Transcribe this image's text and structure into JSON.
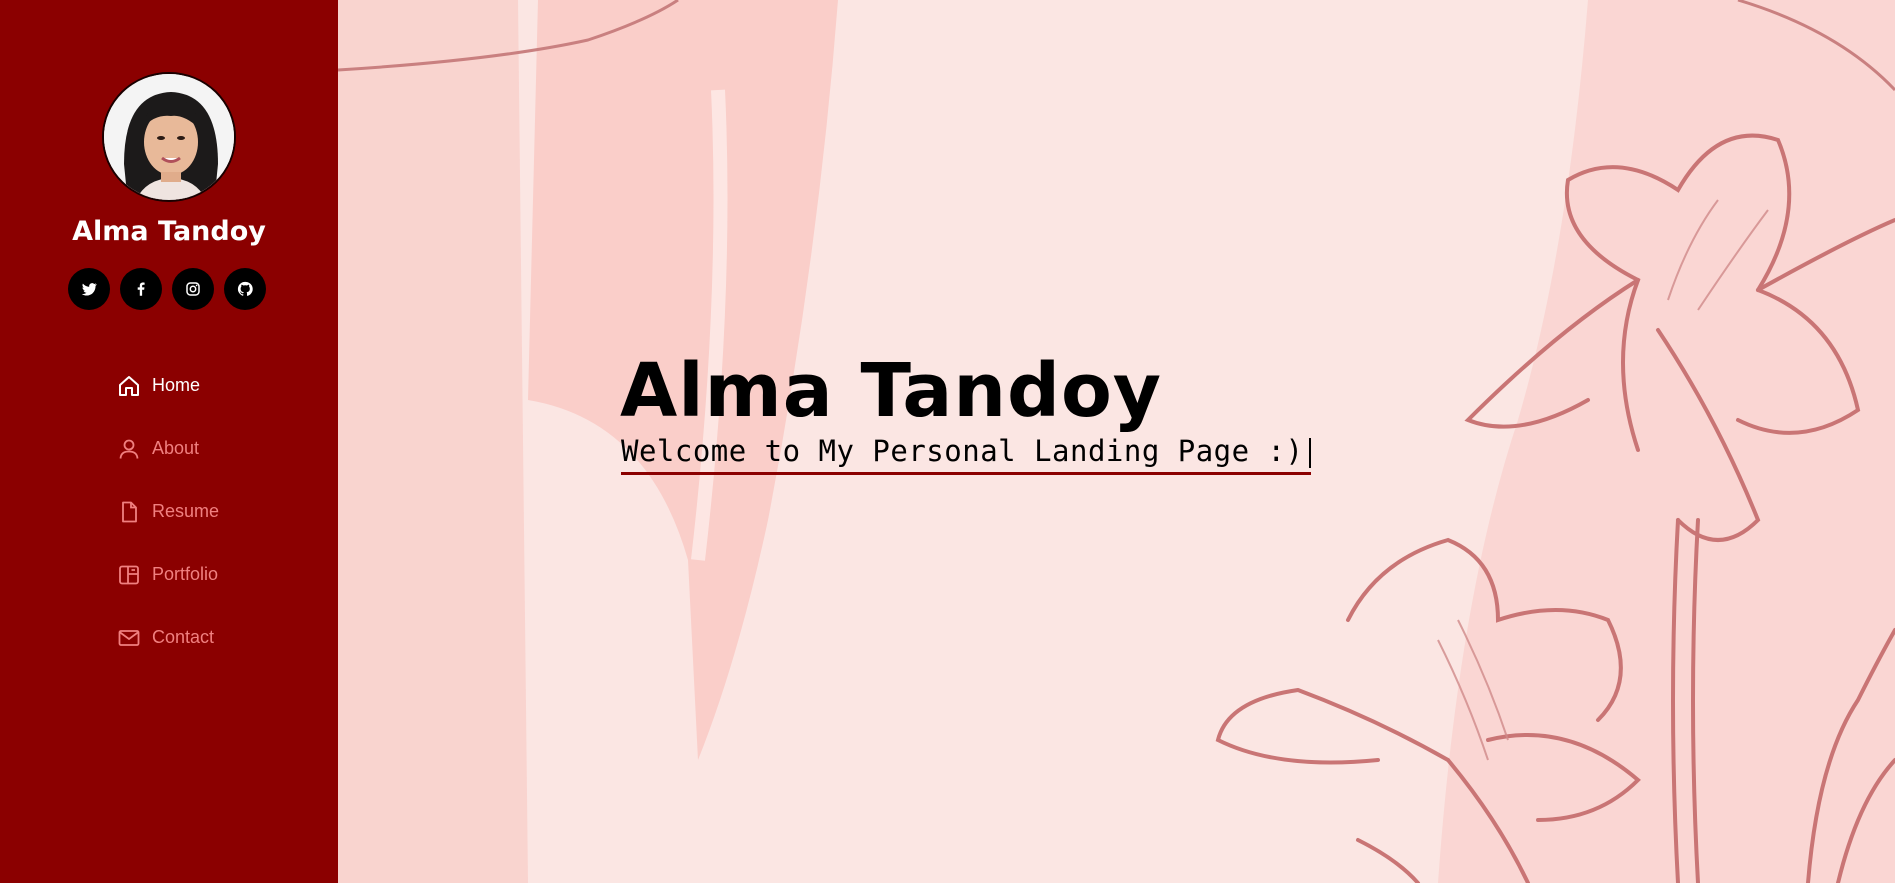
{
  "sidebar": {
    "name": "Alma Tandoy",
    "socials": [
      "twitter-icon",
      "facebook-icon",
      "instagram-icon",
      "github-icon"
    ],
    "nav": [
      {
        "label": "Home",
        "icon": "home-icon",
        "active": true
      },
      {
        "label": "About",
        "icon": "user-icon",
        "active": false
      },
      {
        "label": "Resume",
        "icon": "file-icon",
        "active": false
      },
      {
        "label": "Portfolio",
        "icon": "portfolio-icon",
        "active": false
      },
      {
        "label": "Contact",
        "icon": "envelope-icon",
        "active": false
      }
    ]
  },
  "hero": {
    "title": "Alma Tandoy",
    "subtitle": "Welcome to My Personal Landing Page :)"
  },
  "colors": {
    "sidebar_bg": "#8b0000",
    "nav_inactive": "#f08080",
    "nav_active": "#ffffff",
    "hero_bg": "#fbe6e3",
    "accent_underline": "#8b0000"
  }
}
